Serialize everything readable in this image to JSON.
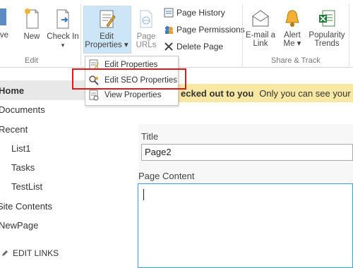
{
  "ribbon": {
    "save_label": "ve",
    "new_label": "New",
    "checkin_label": "Check In",
    "checkin_caret": "▾",
    "edit_group_label": "Edit",
    "edit_properties_label_1": "Edit",
    "edit_properties_label_2": "Properties ▾",
    "page_urls_label_1": "Page",
    "page_urls_label_2": "URLs",
    "page_history_label": "Page History",
    "page_permissions_label": "Page Permissions",
    "delete_page_label": "Delete Page",
    "email_link_label_1": "E-mail a",
    "email_link_label_2": "Link",
    "alert_me_label_1": "Alert",
    "alert_me_label_2": "Me ▾",
    "popularity_trends_label_1": "Popularity",
    "popularity_trends_label_2": "Trends",
    "share_track_group_label": "Share & Track"
  },
  "dropdown": {
    "items": [
      {
        "label": "Edit Properties",
        "icon": "edit-properties-icon"
      },
      {
        "label": "Edit SEO Properties",
        "icon": "seo-search-icon"
      },
      {
        "label": "View Properties",
        "icon": "view-properties-icon"
      }
    ]
  },
  "nav": {
    "items": [
      {
        "label": "Home"
      },
      {
        "label": "Documents"
      },
      {
        "label": "Recent"
      },
      {
        "label": "List1"
      },
      {
        "label": "Tasks"
      },
      {
        "label": "TestList"
      },
      {
        "label": "Site Contents"
      },
      {
        "label": "NewPage"
      }
    ],
    "edit_links_label": "EDIT LINKS"
  },
  "banner": {
    "bold_text": "ecked out to you",
    "message": "Only you can see your r"
  },
  "form": {
    "title_label": "Title",
    "title_value": "Page2",
    "page_content_label": "Page Content"
  },
  "colors": {
    "selected_button_bg": "#cde6f7",
    "banner_bg": "#f8e8a3",
    "highlight_border": "#e0181c",
    "editor_border": "#3e9ce4"
  }
}
